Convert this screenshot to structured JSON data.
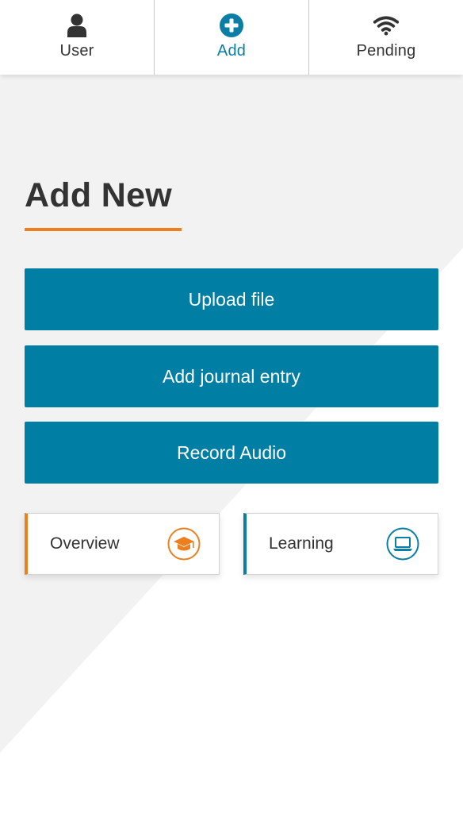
{
  "nav": {
    "items": [
      {
        "label": "User",
        "icon": "user-icon"
      },
      {
        "label": "Add",
        "icon": "plus-circle-icon",
        "active": true
      },
      {
        "label": "Pending",
        "icon": "wifi-icon"
      }
    ]
  },
  "main": {
    "title": "Add New",
    "actions": [
      {
        "label": "Upload file"
      },
      {
        "label": "Add journal entry"
      },
      {
        "label": "Record Audio"
      }
    ],
    "cards": [
      {
        "label": "Overview",
        "icon": "graduation-cap-icon",
        "accent": "#ee7f1f"
      },
      {
        "label": "Learning",
        "icon": "laptop-icon",
        "accent": "#0a7ea4"
      }
    ]
  },
  "colors": {
    "primary": "#007ea3",
    "accent_orange": "#ee7f1f",
    "text": "#333333",
    "background_shape": "#f2f2f2"
  }
}
